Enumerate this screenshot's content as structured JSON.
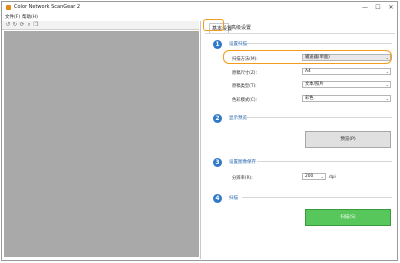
{
  "window": {
    "title": "Color Network ScanGear 2",
    "minimize_glyph": "—",
    "maximize_glyph": "☐",
    "close_glyph": "✕"
  },
  "menu": {
    "items": [
      "文件(F)",
      "帮助(H)"
    ]
  },
  "toolbar": {
    "icons": [
      "rotate-left-icon",
      "rotate-right-icon",
      "refresh-icon",
      "zoom-icon",
      "copy-icon"
    ]
  },
  "tabs": {
    "basic": "基本设置",
    "advanced": "高级设置"
  },
  "step1": {
    "number": "1",
    "title": "设置扫描",
    "rows": [
      {
        "label": "扫描方法(M):",
        "value": "输送器(单面)"
      },
      {
        "label": "原稿尺寸(Z):",
        "value": "A4"
      },
      {
        "label": "原稿类型(T):",
        "value": "文本/照片"
      },
      {
        "label": "色彩模式(C):",
        "value": "彩色"
      }
    ]
  },
  "step2": {
    "number": "2",
    "title": "显示预览",
    "button": "预览(P)"
  },
  "step3": {
    "number": "3",
    "title": "设置图像保存",
    "resolution_label": "分辨率(R):",
    "resolution_value": "200",
    "resolution_unit": "dpi"
  },
  "step4": {
    "number": "4",
    "title": "扫描",
    "button": "扫描(S)"
  },
  "colors": {
    "accent_orange": "#f39c1c",
    "step_blue": "#2f79c8",
    "scan_green": "#57c65b",
    "preview_gray": "#a9a9a9"
  }
}
